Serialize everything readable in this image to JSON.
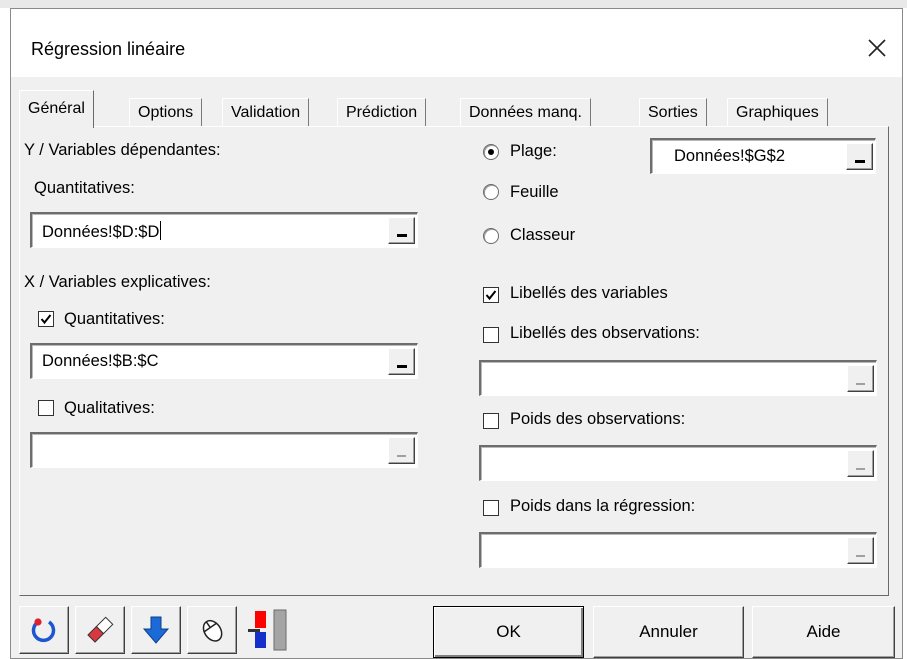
{
  "window": {
    "title": "Régression linéaire"
  },
  "tabs": [
    {
      "label": "Général",
      "active": true
    },
    {
      "label": "Options"
    },
    {
      "label": "Validation"
    },
    {
      "label": "Prédiction"
    },
    {
      "label": "Données manq."
    },
    {
      "label": "Sorties"
    },
    {
      "label": "Graphiques"
    }
  ],
  "y_section": {
    "heading": "Y / Variables dépendantes:",
    "quant_label": "Quantitatives:",
    "quant_value": "Données!$D:$D"
  },
  "x_section": {
    "heading": "X / Variables explicatives:",
    "quant_label": "Quantitatives:",
    "quant_checked": true,
    "quant_value": "Données!$B:$C",
    "qual_label": "Qualitatives:",
    "qual_checked": false,
    "qual_value": ""
  },
  "range_options": {
    "selected": "Plage",
    "plage_label": "Plage:",
    "plage_value": "Données!$G$2",
    "feuille_label": "Feuille",
    "classeur_label": "Classeur"
  },
  "right_options": {
    "libelles_variables_label": "Libellés des variables",
    "libelles_variables_checked": true,
    "libelles_obs_label": "Libellés des observations:",
    "libelles_obs_checked": false,
    "libelles_obs_value": "",
    "poids_obs_label": "Poids des observations:",
    "poids_obs_checked": false,
    "poids_obs_value": "",
    "poids_reg_label": "Poids dans la régression:",
    "poids_reg_checked": false,
    "poids_reg_value": ""
  },
  "toolbar": {
    "icons": [
      "reset-icon",
      "eraser-icon",
      "down-arrow-icon",
      "mouse-icon",
      "colors-icon"
    ]
  },
  "buttons": {
    "ok": "OK",
    "cancel": "Annuler",
    "help": "Aide"
  }
}
